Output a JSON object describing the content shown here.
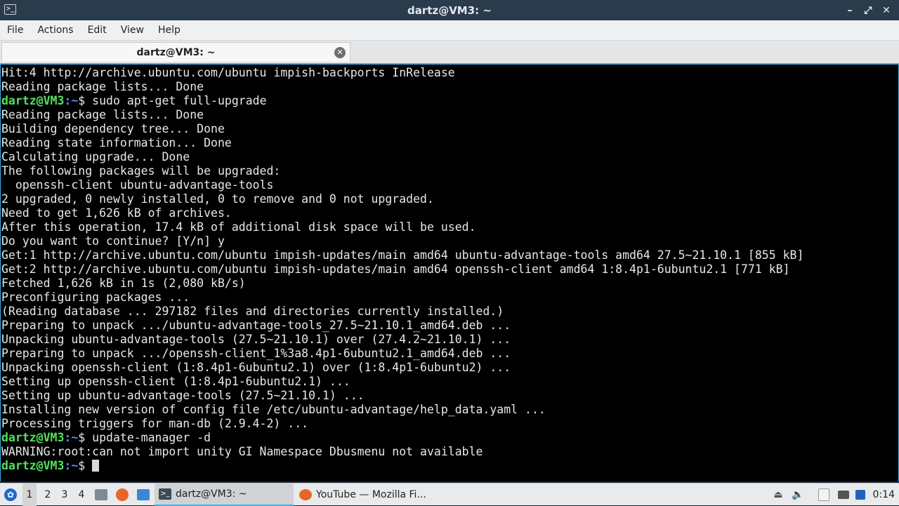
{
  "window": {
    "title": "dartz@VM3: ~",
    "controls": [
      "minimize-icon",
      "maximize-icon",
      "close-icon"
    ]
  },
  "menu": [
    "File",
    "Actions",
    "Edit",
    "View",
    "Help"
  ],
  "tab": {
    "label": "dartz@VM3: ~"
  },
  "prompt": {
    "user_host": "dartz@VM3",
    "path": ":~",
    "symbol": "$ "
  },
  "terminal_lines": [
    {
      "t": "Hit:4 http://archive.ubuntu.com/ubuntu impish-backports InRelease"
    },
    {
      "t": "Reading package lists... Done"
    },
    {
      "prompt": true,
      "cmd": "sudo apt-get full-upgrade"
    },
    {
      "t": "Reading package lists... Done"
    },
    {
      "t": "Building dependency tree... Done"
    },
    {
      "t": "Reading state information... Done"
    },
    {
      "t": "Calculating upgrade... Done"
    },
    {
      "t": "The following packages will be upgraded:"
    },
    {
      "t": "  openssh-client ubuntu-advantage-tools"
    },
    {
      "t": "2 upgraded, 0 newly installed, 0 to remove and 0 not upgraded."
    },
    {
      "t": "Need to get 1,626 kB of archives."
    },
    {
      "t": "After this operation, 17.4 kB of additional disk space will be used."
    },
    {
      "t": "Do you want to continue? [Y/n] y"
    },
    {
      "t": "Get:1 http://archive.ubuntu.com/ubuntu impish-updates/main amd64 ubuntu-advantage-tools amd64 27.5~21.10.1 [855 kB]"
    },
    {
      "t": "Get:2 http://archive.ubuntu.com/ubuntu impish-updates/main amd64 openssh-client amd64 1:8.4p1-6ubuntu2.1 [771 kB]"
    },
    {
      "t": "Fetched 1,626 kB in 1s (2,080 kB/s)"
    },
    {
      "t": "Preconfiguring packages ..."
    },
    {
      "t": "(Reading database ... 297182 files and directories currently installed.)"
    },
    {
      "t": "Preparing to unpack .../ubuntu-advantage-tools_27.5~21.10.1_amd64.deb ..."
    },
    {
      "t": "Unpacking ubuntu-advantage-tools (27.5~21.10.1) over (27.4.2~21.10.1) ..."
    },
    {
      "t": "Preparing to unpack .../openssh-client_1%3a8.4p1-6ubuntu2.1_amd64.deb ..."
    },
    {
      "t": "Unpacking openssh-client (1:8.4p1-6ubuntu2.1) over (1:8.4p1-6ubuntu2) ..."
    },
    {
      "t": "Setting up openssh-client (1:8.4p1-6ubuntu2.1) ..."
    },
    {
      "t": "Setting up ubuntu-advantage-tools (27.5~21.10.1) ..."
    },
    {
      "t": "Installing new version of config file /etc/ubuntu-advantage/help_data.yaml ..."
    },
    {
      "t": "Processing triggers for man-db (2.9.4-2) ..."
    },
    {
      "prompt": true,
      "cmd": "update-manager -d"
    },
    {
      "t": "WARNING:root:can not import unity GI Namespace Dbusmenu not available"
    },
    {
      "prompt": true,
      "cmd": "",
      "cursor": true
    }
  ],
  "taskbar": {
    "workspaces": [
      "1",
      "2",
      "3",
      "4"
    ],
    "active_workspace": "1",
    "launchers": [
      "file-manager-icon",
      "firefox-icon",
      "desktop-icon"
    ],
    "tasks": [
      {
        "label": "dartz@VM3: ~",
        "icon": "terminal-icon",
        "active": true
      },
      {
        "label": "YouTube — Mozilla Fi...",
        "icon": "firefox-icon",
        "active": false
      }
    ],
    "tray": [
      "eject-icon",
      "volume-icon",
      "clipboard-icon",
      "network-icon",
      "keyboard-icon"
    ],
    "clock": "0:14"
  },
  "colors": {
    "prompt_user": "#54e15e",
    "prompt_path": "#5c8df0",
    "accent": "#3daee9",
    "terminal_bg": "#000000"
  }
}
